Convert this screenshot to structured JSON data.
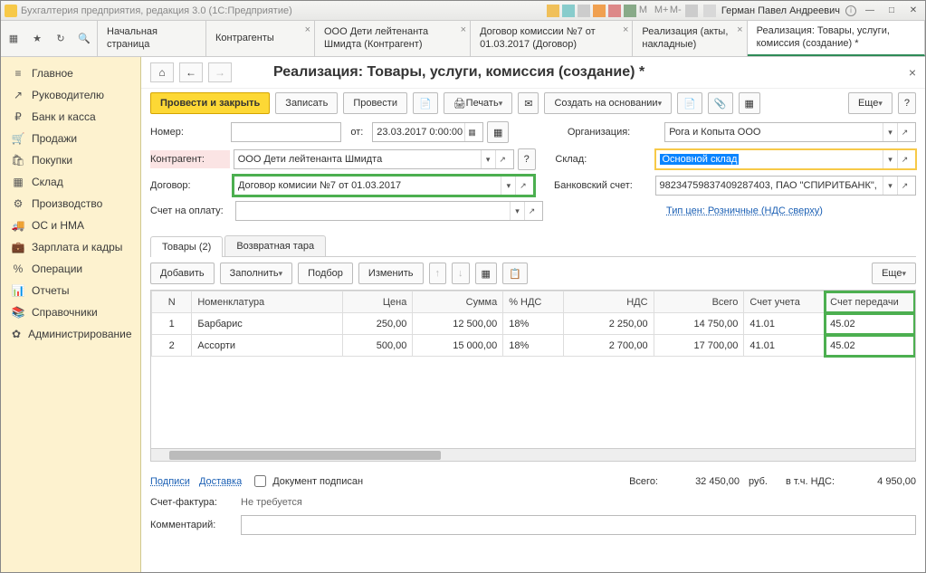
{
  "titlebar": {
    "app_title": "Бухгалтерия предприятия, редакция 3.0 (1С:Предприятие)",
    "user": "Герман Павел Андреевич"
  },
  "tabs": [
    {
      "label": "Начальная страница"
    },
    {
      "label": "Контрагенты"
    },
    {
      "label": "ООО Дети лейтенанта Шмидта (Контрагент)"
    },
    {
      "label": "Договор комиссии №7 от 01.03.2017 (Договор)"
    },
    {
      "label": "Реализация (акты, накладные)"
    },
    {
      "label": "Реализация: Товары, услуги, комиссия (создание) *"
    }
  ],
  "sidebar": [
    {
      "icon": "≡",
      "label": "Главное"
    },
    {
      "icon": "↗",
      "label": "Руководителю"
    },
    {
      "icon": "₽",
      "label": "Банк и касса"
    },
    {
      "icon": "🛒",
      "label": "Продажи"
    },
    {
      "icon": "🛍",
      "label": "Покупки"
    },
    {
      "icon": "▦",
      "label": "Склад"
    },
    {
      "icon": "⚙",
      "label": "Производство"
    },
    {
      "icon": "🚚",
      "label": "ОС и НМА"
    },
    {
      "icon": "💼",
      "label": "Зарплата и кадры"
    },
    {
      "icon": "%",
      "label": "Операции"
    },
    {
      "icon": "📊",
      "label": "Отчеты"
    },
    {
      "icon": "📚",
      "label": "Справочники"
    },
    {
      "icon": "✿",
      "label": "Администрирование"
    }
  ],
  "page": {
    "title": "Реализация: Товары, услуги, комиссия (создание) *"
  },
  "actions": {
    "post_close": "Провести и закрыть",
    "save": "Записать",
    "post": "Провести",
    "print": "Печать",
    "create_based": "Создать на основании",
    "more": "Еще"
  },
  "form": {
    "number_label": "Номер:",
    "number_value": "",
    "date_label": "от:",
    "date_value": "23.03.2017 0:00:00",
    "org_label": "Организация:",
    "org_value": "Рога и Копыта ООО",
    "contragent_label": "Контрагент:",
    "contragent_value": "ООО Дети лейтенанта Шмидта",
    "sklad_label": "Склад:",
    "sklad_value": "Основной склад",
    "dogovor_label": "Договор:",
    "dogovor_value": "Договор комисии №7 от 01.03.2017",
    "bank_label": "Банковский счет:",
    "bank_value": "98234759837409287403, ПАО \"СПИРИТБАНК\",",
    "schet_oplatu_label": "Счет на оплату:",
    "schet_oplatu_value": "",
    "price_type_label": "Тип цен: Розничные (НДС сверху)"
  },
  "inner_tabs": {
    "goods": "Товары (2)",
    "tara": "Возвратная тара"
  },
  "grid_actions": {
    "add": "Добавить",
    "fill": "Заполнить",
    "pick": "Подбор",
    "change": "Изменить",
    "more": "Еще"
  },
  "columns": {
    "n": "N",
    "nom": "Номенклатура",
    "price": "Цена",
    "sum": "Сумма",
    "vat_pct": "% НДС",
    "vat": "НДС",
    "total": "Всего",
    "acct": "Счет учета",
    "transfer": "Счет передачи"
  },
  "rows": [
    {
      "n": "1",
      "nom": "Барбарис",
      "price": "250,00",
      "sum": "12 500,00",
      "vat_pct": "18%",
      "vat": "2 250,00",
      "total": "14 750,00",
      "acct": "41.01",
      "transfer": "45.02"
    },
    {
      "n": "2",
      "nom": "Ассорти",
      "price": "500,00",
      "sum": "15 000,00",
      "vat_pct": "18%",
      "vat": "2 700,00",
      "total": "17 700,00",
      "acct": "41.01",
      "transfer": "45.02"
    }
  ],
  "footer": {
    "podpisi": "Подписи",
    "dostavka": "Доставка",
    "doc_signed": "Документ подписан",
    "total_label": "Всего:",
    "total_value": "32 450,00",
    "currency": "руб.",
    "vat_label": "в т.ч. НДС:",
    "vat_value": "4 950,00",
    "sf_label": "Счет-фактура:",
    "sf_value": "Не требуется",
    "comment_label": "Комментарий:"
  }
}
